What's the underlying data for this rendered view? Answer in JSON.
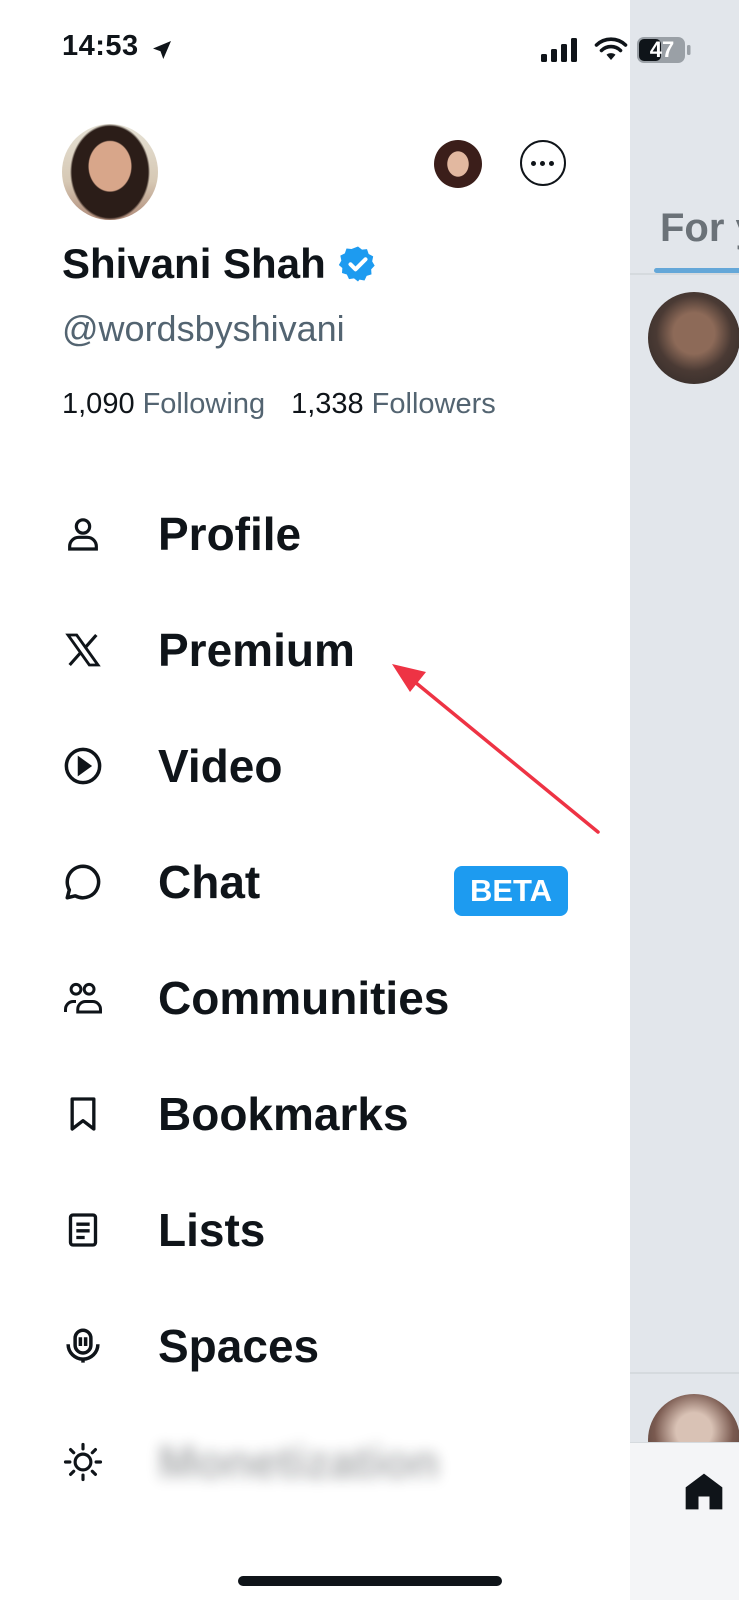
{
  "status_bar": {
    "time": "14:53",
    "battery": "47"
  },
  "profile": {
    "name": "Shivani Shah",
    "handle": "@wordsbyshivani",
    "following_count": "1,090",
    "following_label": "Following",
    "followers_count": "1,338",
    "followers_label": "Followers"
  },
  "menu": [
    {
      "label": "Profile",
      "icon": "person-icon"
    },
    {
      "label": "Premium",
      "icon": "x-logo-icon"
    },
    {
      "label": "Video",
      "icon": "play-circle-icon"
    },
    {
      "label": "Chat",
      "icon": "chat-bubble-icon",
      "badge": "BETA"
    },
    {
      "label": "Communities",
      "icon": "communities-icon"
    },
    {
      "label": "Bookmarks",
      "icon": "bookmark-icon"
    },
    {
      "label": "Lists",
      "icon": "list-icon"
    },
    {
      "label": "Spaces",
      "icon": "spaces-mic-icon"
    },
    {
      "label": "Monetization",
      "icon": "sun-icon"
    }
  ],
  "background_feed": {
    "tab_label": "For y"
  },
  "colors": {
    "accent": "#1d9bf0",
    "secondary_text": "#536471",
    "annotation_arrow": "#ee3344"
  }
}
